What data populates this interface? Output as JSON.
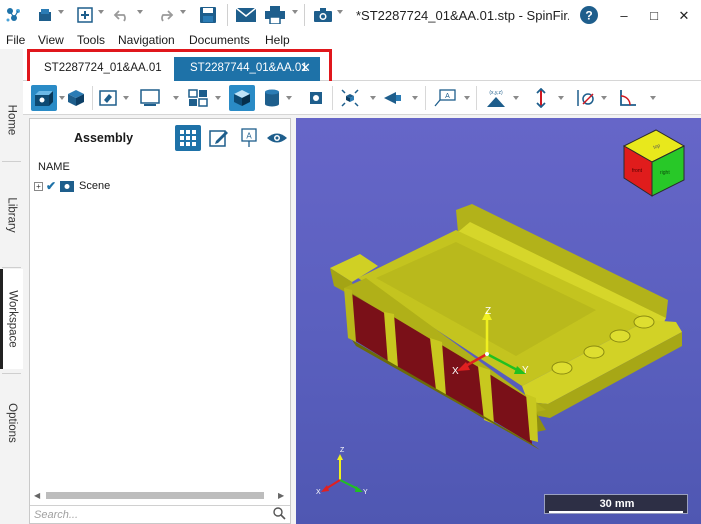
{
  "window": {
    "title": "*ST2287724_01&AA.01.stp - SpinFir...",
    "minimize": "–",
    "maximize": "□",
    "close": "✕"
  },
  "quick_access": [
    "logo-icon",
    "save-as-icon",
    "add-icon",
    "undo-icon",
    "redo-icon",
    "save-icon",
    "mail-icon",
    "print-icon",
    "screenshot-icon",
    "help-icon"
  ],
  "menu": [
    "File",
    "View",
    "Tools",
    "Navigation",
    "Documents",
    "Help"
  ],
  "tabs": [
    {
      "label": "ST2287724_01&AA.01",
      "active": false
    },
    {
      "label": "ST2287744_01&AA.01",
      "active": true,
      "close": "✕"
    }
  ],
  "side_tabs": [
    "Home",
    "Library",
    "Workspace",
    "Options"
  ],
  "panel": {
    "title": "Assembly",
    "column_header": "NAME",
    "tree": [
      {
        "label": "Scene",
        "checked": true,
        "expander": "+"
      }
    ],
    "search_placeholder": "Search..."
  },
  "viewport": {
    "scale_label": "30 mm",
    "axes": {
      "x": "X",
      "y": "Y",
      "z": "Z"
    },
    "triad_labels": {
      "x": "X",
      "y": "Y",
      "z": "Z"
    },
    "view_cube": {
      "top": "top",
      "front": "front",
      "right": "right"
    }
  },
  "colors": {
    "accent": "#1e72a8",
    "highlight": "#e0171c",
    "viewport_bg": "#5a5fbe",
    "part_yellow": "#c8c81c",
    "part_red": "#7a1018"
  }
}
